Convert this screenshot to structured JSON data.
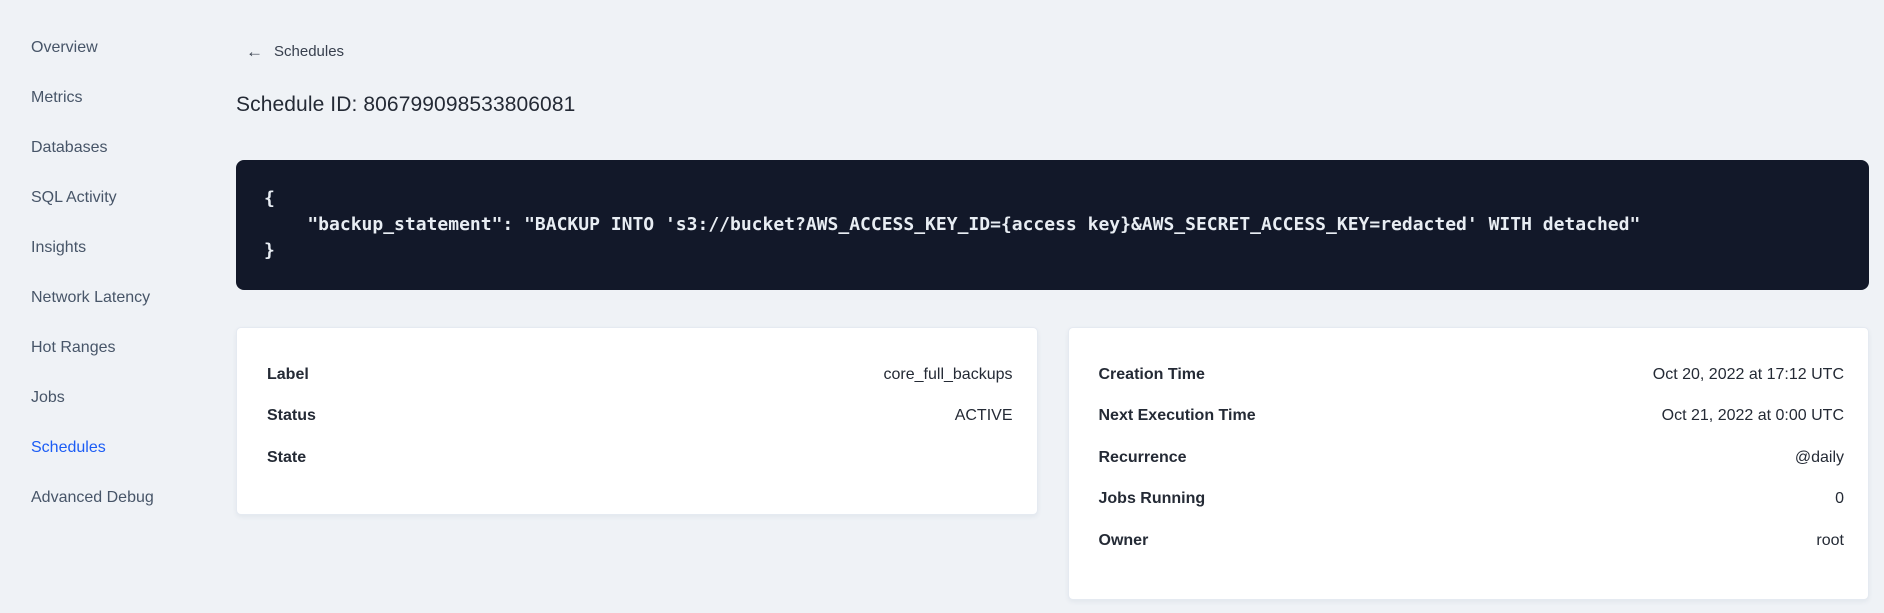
{
  "sidebar": {
    "items": [
      {
        "label": "Overview",
        "active": false
      },
      {
        "label": "Metrics",
        "active": false
      },
      {
        "label": "Databases",
        "active": false
      },
      {
        "label": "SQL Activity",
        "active": false
      },
      {
        "label": "Insights",
        "active": false
      },
      {
        "label": "Network Latency",
        "active": false
      },
      {
        "label": "Hot Ranges",
        "active": false
      },
      {
        "label": "Jobs",
        "active": false
      },
      {
        "label": "Schedules",
        "active": true
      },
      {
        "label": "Advanced Debug",
        "active": false
      }
    ]
  },
  "header": {
    "back_icon": "←",
    "back_label": "Schedules",
    "title": "Schedule ID: 806799098533806081"
  },
  "code_block": {
    "lines": [
      {
        "text": "{"
      },
      {
        "text": "    \"backup_statement\": \"BACKUP INTO 's3://bucket?AWS_ACCESS_KEY_ID={access key}&AWS_SECRET_ACCESS_KEY=redacted' WITH detached\""
      },
      {
        "text": "}"
      }
    ]
  },
  "summary_cards": {
    "schedule_card": {
      "rows": [
        {
          "label": "Label",
          "value": "core_full_backups"
        },
        {
          "label": "Status",
          "value": "ACTIVE"
        },
        {
          "label": "State",
          "value": ""
        }
      ]
    },
    "execution_card": {
      "rows": [
        {
          "label": "Creation Time",
          "value": "Oct 20, 2022 at 17:12 UTC"
        },
        {
          "label": "Next Execution Time",
          "value": "Oct 21, 2022 at 0:00 UTC"
        },
        {
          "label": "Recurrence",
          "value": "@daily"
        },
        {
          "label": "Jobs Running",
          "value": "0"
        },
        {
          "label": "Owner",
          "value": "root"
        }
      ]
    }
  },
  "colors": {
    "page_bg": "#eff2f6",
    "card_bg": "#ffffff",
    "code_bg": "#121829",
    "code_text": "#e8edf3",
    "accent_blue": "#1b5cf5",
    "text_dark": "#242a35",
    "sidebar_text": "#475568"
  }
}
